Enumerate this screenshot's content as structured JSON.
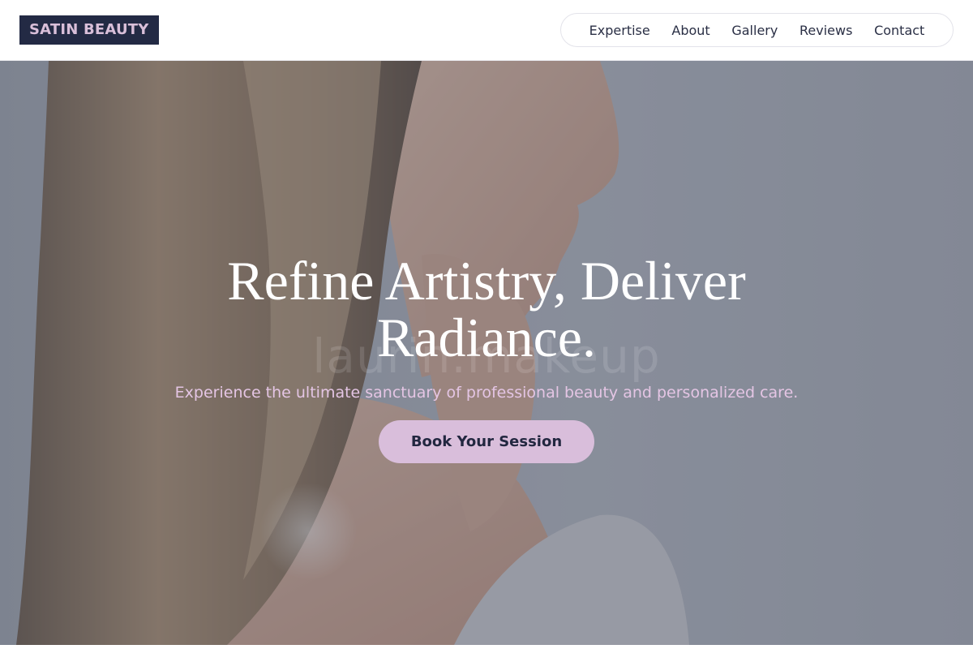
{
  "header": {
    "logo": "SATIN BEAUTY",
    "nav": [
      {
        "label": "Expertise"
      },
      {
        "label": "About"
      },
      {
        "label": "Gallery"
      },
      {
        "label": "Reviews"
      },
      {
        "label": "Contact"
      }
    ]
  },
  "hero": {
    "title": "Refine Artistry, Deliver Radiance.",
    "subtitle": "Experience the ultimate sanctuary of professional beauty and personalized care.",
    "cta": "Book Your Session",
    "watermark": "laurin.makeup"
  },
  "colors": {
    "brand_dark": "#232a44",
    "brand_accent": "#d9bedb",
    "subtitle_text": "#e4c5e4"
  }
}
